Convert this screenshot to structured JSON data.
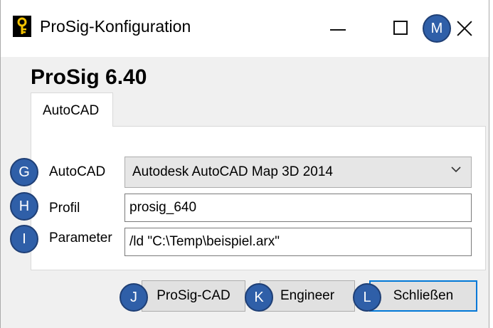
{
  "window": {
    "title": "ProSig-Konfiguration"
  },
  "heading": "ProSig 6.40",
  "tab": {
    "label": "AutoCAD"
  },
  "form": {
    "autocad_label": "AutoCAD",
    "autocad_value": "Autodesk AutoCAD Map 3D 2014",
    "profil_label": "Profil",
    "profil_value": "prosig_640",
    "parameter_label": "Parameter",
    "parameter_value": "/ld \"C:\\Temp\\beispiel.arx\""
  },
  "buttons": {
    "prosig_cad": "ProSig-CAD",
    "engineer": "Engineer",
    "close": "Schließen"
  },
  "annotations": {
    "g": "G",
    "h": "H",
    "i": "I",
    "j": "J",
    "k": "K",
    "l": "L",
    "m": "M"
  },
  "colors": {
    "badge": "#2f5fa8",
    "default_button_border": "#0078d7"
  }
}
